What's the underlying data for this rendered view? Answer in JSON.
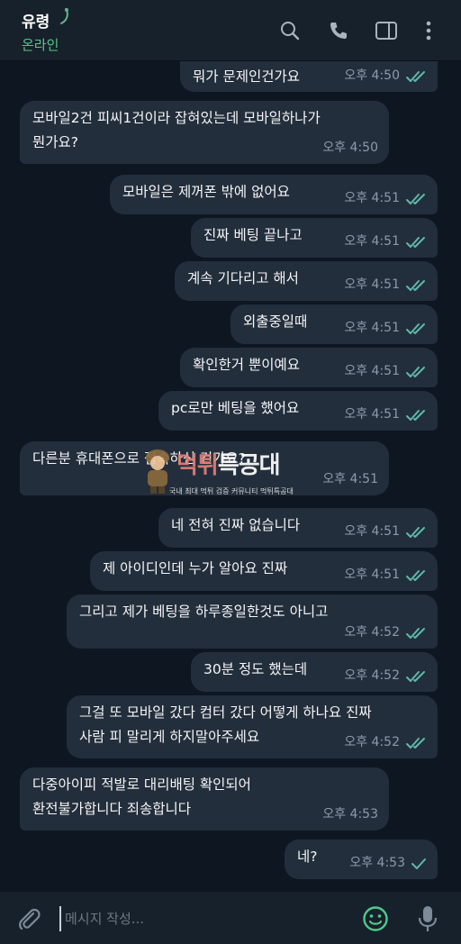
{
  "header": {
    "contact_name": "유령",
    "status": "온라인",
    "icons": [
      "search-icon",
      "phone-icon",
      "sidebar-toggle-icon",
      "more-vert-icon"
    ]
  },
  "messages": [
    {
      "dir": "out",
      "text": "뭐가 문제인건가요",
      "time": "오후 4:50",
      "check": "double"
    },
    {
      "dir": "in",
      "text": "모바일2건 피씨1건이라 잡혀있는데 모바일하나가\n뭔가요?",
      "time": "오후 4:50"
    },
    {
      "dir": "out",
      "text": "모바일은 제꺼폰 밖에 없어요",
      "time": "오후 4:51",
      "check": "double"
    },
    {
      "dir": "out",
      "text": "진짜 베팅 끝나고",
      "time": "오후 4:51",
      "check": "double"
    },
    {
      "dir": "out",
      "text": "계속 기다리고 해서",
      "time": "오후 4:51",
      "check": "double"
    },
    {
      "dir": "out",
      "text": "외출중일때",
      "time": "오후 4:51",
      "check": "double"
    },
    {
      "dir": "out",
      "text": "확인한거 뿐이예요",
      "time": "오후 4:51",
      "check": "double"
    },
    {
      "dir": "out",
      "text": "pc로만 베팅을 했어요",
      "time": "오후 4:51",
      "check": "double"
    },
    {
      "dir": "in",
      "text": "다른분 휴대폰으로 접속하신 건가요?",
      "time": "오후 4:51"
    },
    {
      "dir": "out",
      "text": "네 전혀 진짜 없습니다",
      "time": "오후 4:51",
      "check": "double"
    },
    {
      "dir": "out",
      "text": "제 아이디인데 누가 알아요 진짜",
      "time": "오후 4:51",
      "check": "double"
    },
    {
      "dir": "out",
      "text": "그리고 제가 베팅을 하루종일한것도 아니고",
      "time": "오후 4:52",
      "check": "double"
    },
    {
      "dir": "out",
      "text": "30분 정도 했는데",
      "time": "오후 4:52",
      "check": "double"
    },
    {
      "dir": "out",
      "text": "그걸 또 모바일 갔다 컴터 갔다 어떻게 하나요 진짜\n사람 피 말리게 하지말아주세요",
      "time": "오후 4:52",
      "check": "double"
    },
    {
      "dir": "in",
      "text": "다중아이피 적발로 대리배팅 확인되어\n환전불가합니다 죄송합니다",
      "time": "오후 4:53"
    },
    {
      "dir": "out",
      "text": "네?",
      "time": "오후 4:53",
      "check": "single"
    }
  ],
  "composer": {
    "placeholder": "메시지 작성..."
  },
  "watermark": {
    "title_a": "먹튀",
    "title_b": "특공대",
    "subtitle": "국내 최대 먹튀 검증 커뮤니티 먹튀특공대"
  },
  "colors": {
    "background": "#0e1621",
    "header": "#17212b",
    "bubble": "#232e3c",
    "accent_green": "#50c98a",
    "check_color": "#5fb8a8",
    "time_color": "#8b9aab"
  }
}
